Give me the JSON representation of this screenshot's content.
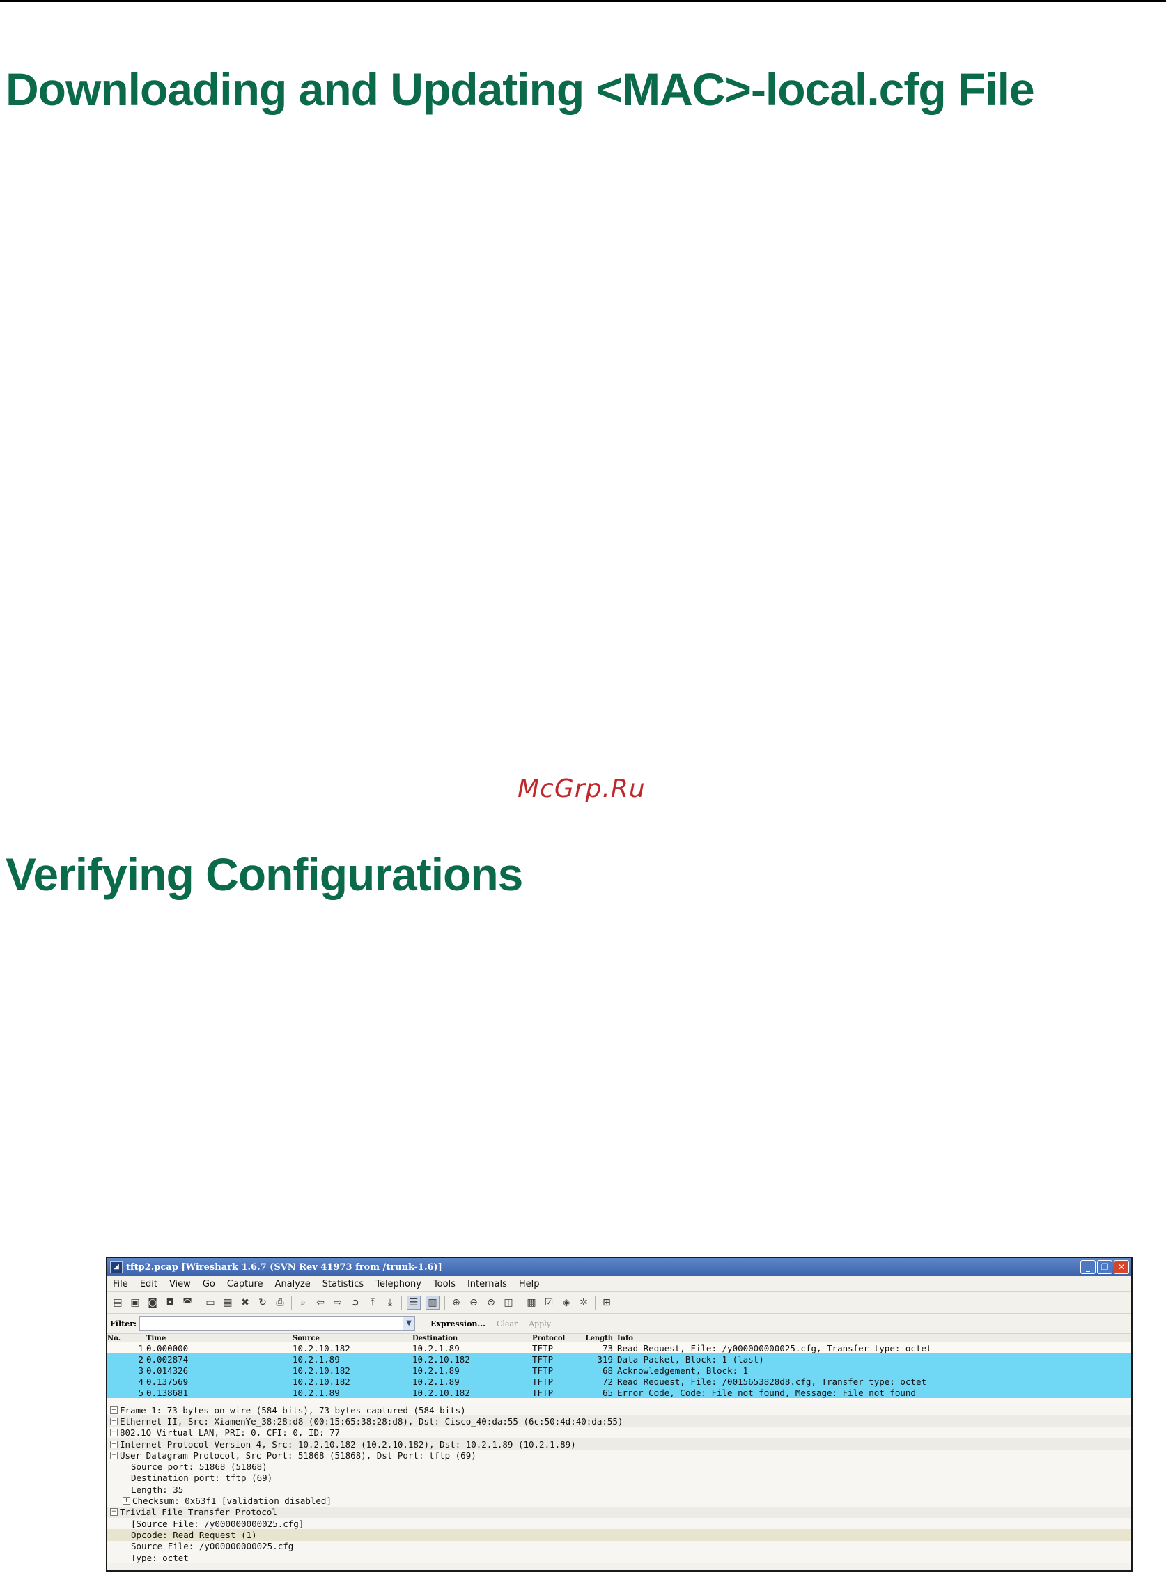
{
  "doc": {
    "heading_1": "Downloading and Updating <MAC>-local.cfg File",
    "watermark": "McGrp.Ru",
    "heading_2": "Verifying Configurations"
  },
  "wireshark": {
    "title": "tftp2.pcap   [Wireshark 1.6.7  (SVN Rev 41973 from /trunk-1.6)]",
    "menu": [
      "File",
      "Edit",
      "View",
      "Go",
      "Capture",
      "Analyze",
      "Statistics",
      "Telephony",
      "Tools",
      "Internals",
      "Help"
    ],
    "filter": {
      "label": "Filter:",
      "value": "",
      "expression": "Expression...",
      "clear": "Clear",
      "apply": "Apply"
    },
    "columns": [
      "No.",
      "Time",
      "Source",
      "Destination",
      "Protocol",
      "Length",
      "Info"
    ],
    "packets": [
      {
        "no": "1",
        "time": "0.000000",
        "src": "10.2.10.182",
        "dst": "10.2.1.89",
        "proto": "TFTP",
        "len": "73",
        "info": "Read Request, File: /y000000000025.cfg, Transfer type: octet"
      },
      {
        "no": "2",
        "time": "0.002874",
        "src": "10.2.1.89",
        "dst": "10.2.10.182",
        "proto": "TFTP",
        "len": "319",
        "info": "Data Packet, Block: 1 (last)"
      },
      {
        "no": "3",
        "time": "0.014326",
        "src": "10.2.10.182",
        "dst": "10.2.1.89",
        "proto": "TFTP",
        "len": "68",
        "info": "Acknowledgement, Block: 1"
      },
      {
        "no": "4",
        "time": "0.137569",
        "src": "10.2.10.182",
        "dst": "10.2.1.89",
        "proto": "TFTP",
        "len": "72",
        "info": "Read Request, File: /0015653828d8.cfg, Transfer type: octet"
      },
      {
        "no": "5",
        "time": "0.138681",
        "src": "10.2.1.89",
        "dst": "10.2.10.182",
        "proto": "TFTP",
        "len": "65",
        "info": "Error Code, Code: File not found, Message: File not found"
      }
    ],
    "details": [
      "Frame 1: 73 bytes on wire (584 bits), 73 bytes captured (584 bits)",
      "Ethernet II, Src: XiamenYe_38:28:d8 (00:15:65:38:28:d8), Dst: Cisco_40:da:55 (6c:50:4d:40:da:55)",
      "802.1Q Virtual LAN, PRI: 0, CFI: 0, ID: 77",
      "Internet Protocol Version 4, Src: 10.2.10.182 (10.2.10.182), Dst: 10.2.1.89 (10.2.1.89)",
      "User Datagram Protocol, Src Port: 51868 (51868), Dst Port: tftp (69)",
      "Source port: 51868 (51868)",
      "Destination port: tftp (69)",
      "Length: 35",
      "Checksum: 0x63f1 [validation disabled]",
      "Trivial File Transfer Protocol",
      "[Source File: /y000000000025.cfg]",
      "Opcode: Read Request (1)",
      "Source File: /y000000000025.cfg",
      "Type: octet"
    ]
  }
}
